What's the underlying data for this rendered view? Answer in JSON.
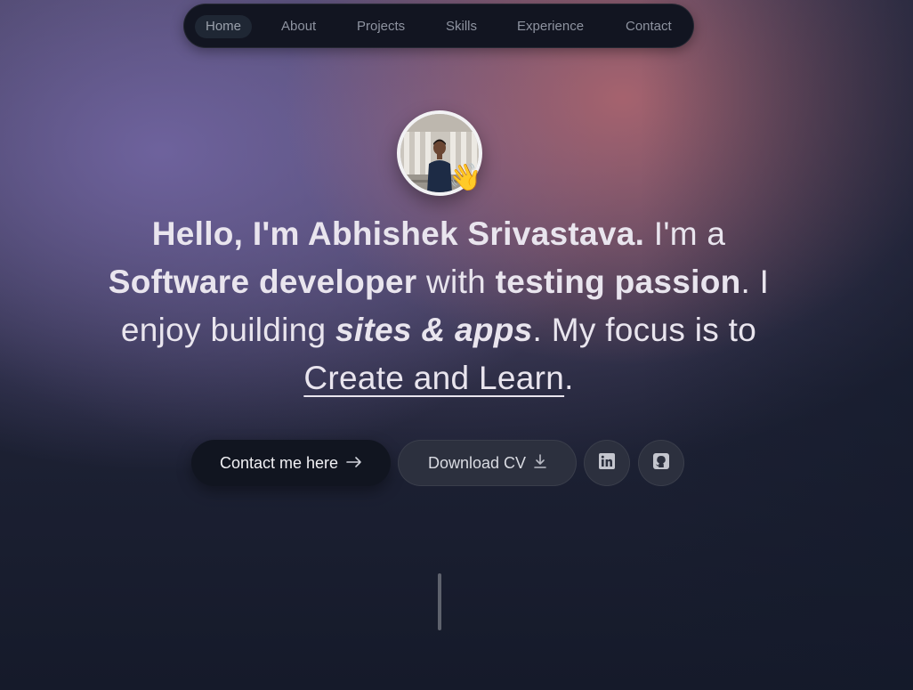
{
  "nav": {
    "items": [
      {
        "label": "Home",
        "active": true
      },
      {
        "label": "About"
      },
      {
        "label": "Projects"
      },
      {
        "label": "Skills"
      },
      {
        "label": "Experience"
      },
      {
        "label": "Contact"
      }
    ]
  },
  "hero": {
    "avatar_badge_emoji": "👋",
    "intro": {
      "greeting": "Hello, I'm Abhishek Srivastava.",
      "im_a": " I'm a ",
      "role": "Software developer",
      "with": " with ",
      "passion": "testing passion",
      "enjoy": ". I enjoy building ",
      "what": "sites & apps",
      "focus": ". My focus is to ",
      "motto": "Create and Learn",
      "end": "."
    },
    "buttons": {
      "contact_label": "Contact me here",
      "contact_icon": "arrow-right-icon",
      "cv_label": "Download CV",
      "cv_icon": "download-icon",
      "linkedin_icon": "linkedin-icon",
      "github_icon": "github-icon"
    }
  },
  "colors": {
    "nav_bg": "#121521",
    "accent_pink": "#aa646e",
    "accent_purple": "#7064a0",
    "page_dark": "#141a2b",
    "text": "#e9e5ee"
  }
}
